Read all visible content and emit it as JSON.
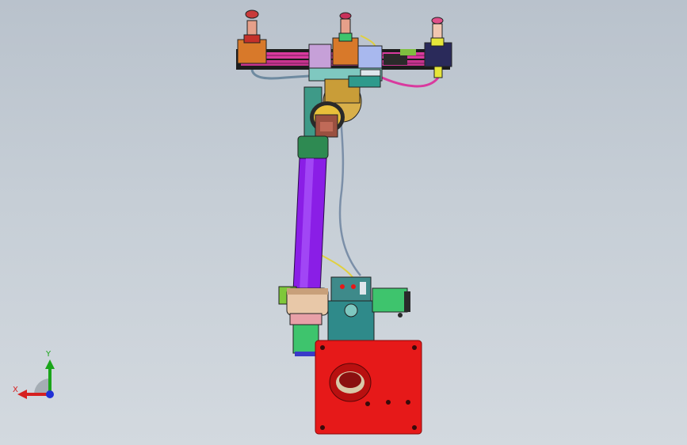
{
  "viewport": {
    "background_top": "#b9c2cc",
    "background_bottom": "#d3d9df"
  },
  "model": {
    "parts": [
      {
        "name": "base-plate",
        "color": "#e61919"
      },
      {
        "name": "vertical-arm",
        "color": "#8a1ee6"
      },
      {
        "name": "rail",
        "color": "#d93a9e"
      },
      {
        "name": "motor",
        "color": "#3ec46d"
      },
      {
        "name": "joint",
        "color": "#2f9a8c"
      }
    ]
  },
  "triad": {
    "x_label": "X",
    "y_label": "Y",
    "x_color": "#d62020",
    "y_color": "#1aa51a",
    "z_color": "#2030d6",
    "x_icon": "arrow-left-icon",
    "y_icon": "arrow-up-icon"
  }
}
